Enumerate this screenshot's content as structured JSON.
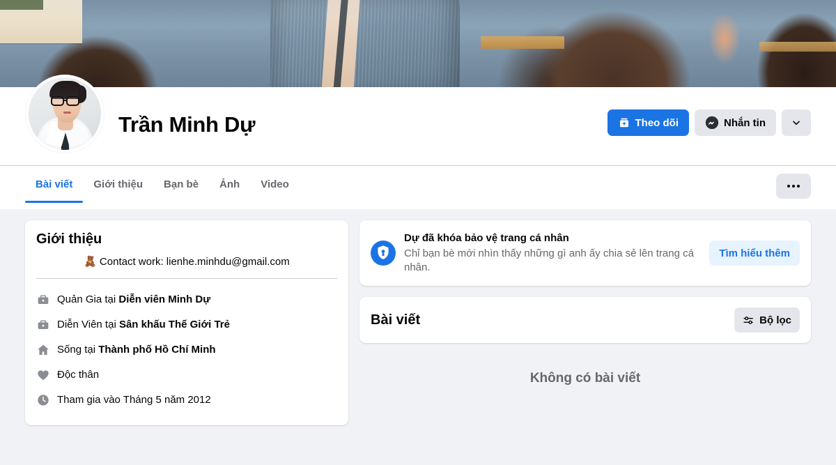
{
  "profile": {
    "name": "Trần Minh Dự",
    "avatar_alt": "profile-photo",
    "cover_alt": "cover-photo"
  },
  "actions": {
    "follow_label": "Theo dõi",
    "message_label": "Nhắn tin",
    "follow_icon": "follow-plus-icon",
    "message_icon": "messenger-icon",
    "more_icon": "chevron-down-icon"
  },
  "tabs": [
    {
      "label": "Bài viết",
      "active": true
    },
    {
      "label": "Giới thiệu",
      "active": false
    },
    {
      "label": "Bạn bè",
      "active": false
    },
    {
      "label": "Ảnh",
      "active": false
    },
    {
      "label": "Video",
      "active": false
    }
  ],
  "tabbar": {
    "more_icon": "ellipsis-icon"
  },
  "intro": {
    "title": "Giới thiệu",
    "bio_emoji": "🧸",
    "bio_text": "Contact work: lienhe.minhdu@gmail.com",
    "items": [
      {
        "icon": "briefcase-icon",
        "prefix": "Quản Gia tại ",
        "strong": "Diễn viên Minh Dự",
        "suffix": ""
      },
      {
        "icon": "briefcase-icon",
        "prefix": "Diễn Viên tại ",
        "strong": "Sân khấu Thế Giới Trẻ",
        "suffix": ""
      },
      {
        "icon": "home-icon",
        "prefix": "Sống tại ",
        "strong": "Thành phố Hồ Chí Minh",
        "suffix": ""
      },
      {
        "icon": "heart-icon",
        "prefix": "Độc thân",
        "strong": "",
        "suffix": ""
      },
      {
        "icon": "clock-icon",
        "prefix": "Tham gia vào Tháng 5 năm 2012",
        "strong": "",
        "suffix": ""
      }
    ]
  },
  "notice": {
    "icon": "shield-lock-icon",
    "title": "Dự đã khóa bảo vệ trang cá nhân",
    "subtitle": "Chỉ bạn bè mới nhìn thấy những gì anh ấy chia sẻ lên trang cá nhân.",
    "button_label": "Tìm hiểu thêm"
  },
  "posts": {
    "title": "Bài viết",
    "filter_label": "Bộ lọc",
    "filter_icon": "sliders-icon",
    "empty_label": "Không có bài viết"
  },
  "colors": {
    "accent": "#1b74e4",
    "page_bg": "#f0f2f5",
    "card_bg": "#ffffff",
    "secondary_btn": "#e4e6eb",
    "muted_text": "#65676b",
    "light_blue_btn": "#e7f3ff"
  }
}
